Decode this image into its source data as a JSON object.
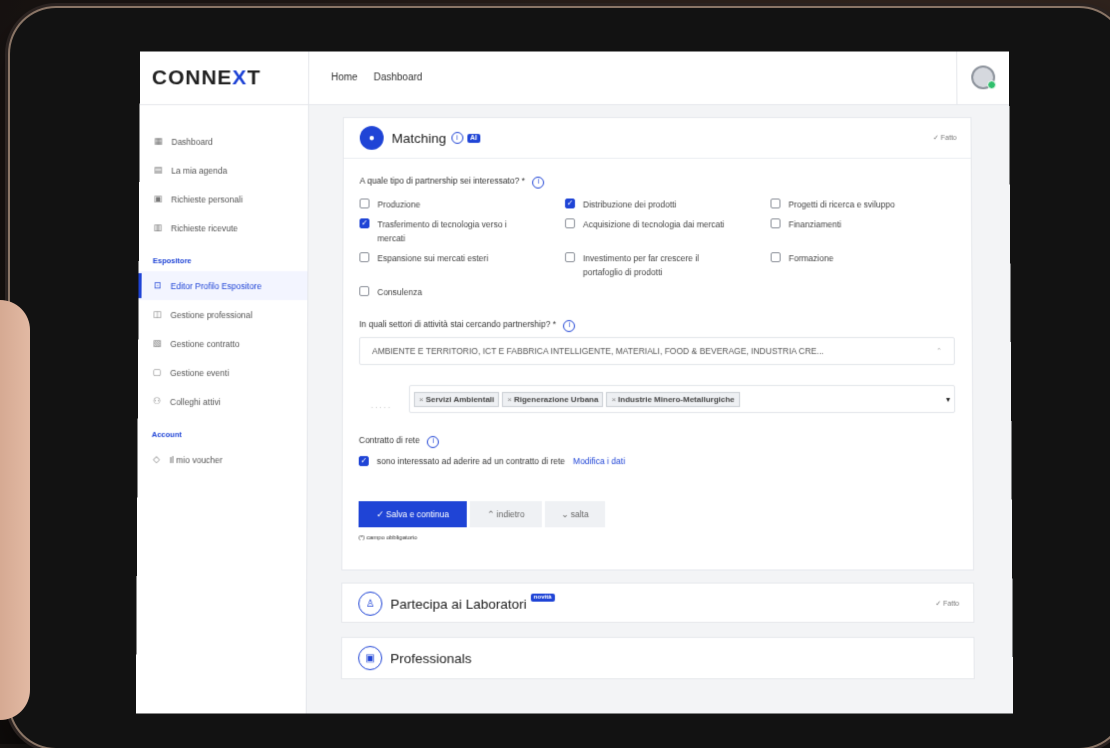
{
  "app": {
    "logo_pre": "CONNE",
    "logo_x": "X",
    "logo_post": "T"
  },
  "topbar": {
    "home": "Home",
    "dashboard": "Dashboard"
  },
  "sidebar": {
    "items": [
      {
        "label": "Dashboard",
        "icon": "grid-icon"
      },
      {
        "label": "La mia agenda",
        "icon": "calendar-icon"
      },
      {
        "label": "Richieste personali",
        "icon": "inbox-icon"
      },
      {
        "label": "Richieste ricevute",
        "icon": "document-icon"
      }
    ],
    "section_espositore": "Espositore",
    "espositore_items": [
      {
        "label": "Editor Profilo Espositore",
        "icon": "editor-icon",
        "active": true
      },
      {
        "label": "Gestione professional",
        "icon": "person-icon"
      },
      {
        "label": "Gestione contratto",
        "icon": "contract-icon"
      },
      {
        "label": "Gestione eventi",
        "icon": "event-icon"
      },
      {
        "label": "Colleghi attivi",
        "icon": "people-icon"
      }
    ],
    "section_account": "Account",
    "account_items": [
      {
        "label": "Il mio voucher",
        "icon": "tag-icon"
      }
    ]
  },
  "matching": {
    "title": "Matching",
    "ai": "AI",
    "done": "✓ Fatto",
    "q1": "A quale tipo di partnership sei interessato? *",
    "options": [
      {
        "label": "Produzione",
        "checked": false
      },
      {
        "label": "Distribuzione dei prodotti",
        "checked": true
      },
      {
        "label": "Progetti di ricerca e sviluppo",
        "checked": false
      },
      {
        "label": "Trasferimento di tecnologia verso i",
        "label2": "mercati",
        "checked": true
      },
      {
        "label": "Acquisizione di tecnologia dai mercati",
        "checked": false
      },
      {
        "label": "Finanziamenti",
        "checked": false
      },
      {
        "label": "Espansione sui mercati esteri",
        "checked": false
      },
      {
        "label": "Investimento per far crescere il",
        "label2": "portafoglio di prodotti",
        "checked": false
      },
      {
        "label": "Formazione",
        "checked": false
      },
      {
        "label": "Consulenza",
        "checked": false
      }
    ],
    "q2": "In quali settori di attività stai cercando partnership? *",
    "sectors_value": "AMBIENTE E TERRITORIO, ICT E FABBRICA INTELLIGENTE, MATERIALI, FOOD & BEVERAGE, INDUSTRIA CRE...",
    "dots": ".....",
    "tags": [
      "Servizi Ambientali",
      "Rigenerazione Urbana",
      "Industrie Minero-Metallurgiche"
    ],
    "contract_label": "Contratto di rete",
    "contract_option": "sono interessato ad aderire ad un contratto di rete",
    "contract_link": "Modifica i dati",
    "btn_save": "✓ Salva e continua",
    "btn_back": "⌃ indietro",
    "btn_skip": "⌄ salta",
    "mandatory": "(*) campo obbligatorio"
  },
  "laboratori": {
    "title": "Partecipa ai Laboratori",
    "badge": "novità",
    "done": "✓ Fatto"
  },
  "professionals": {
    "title": "Professionals"
  }
}
